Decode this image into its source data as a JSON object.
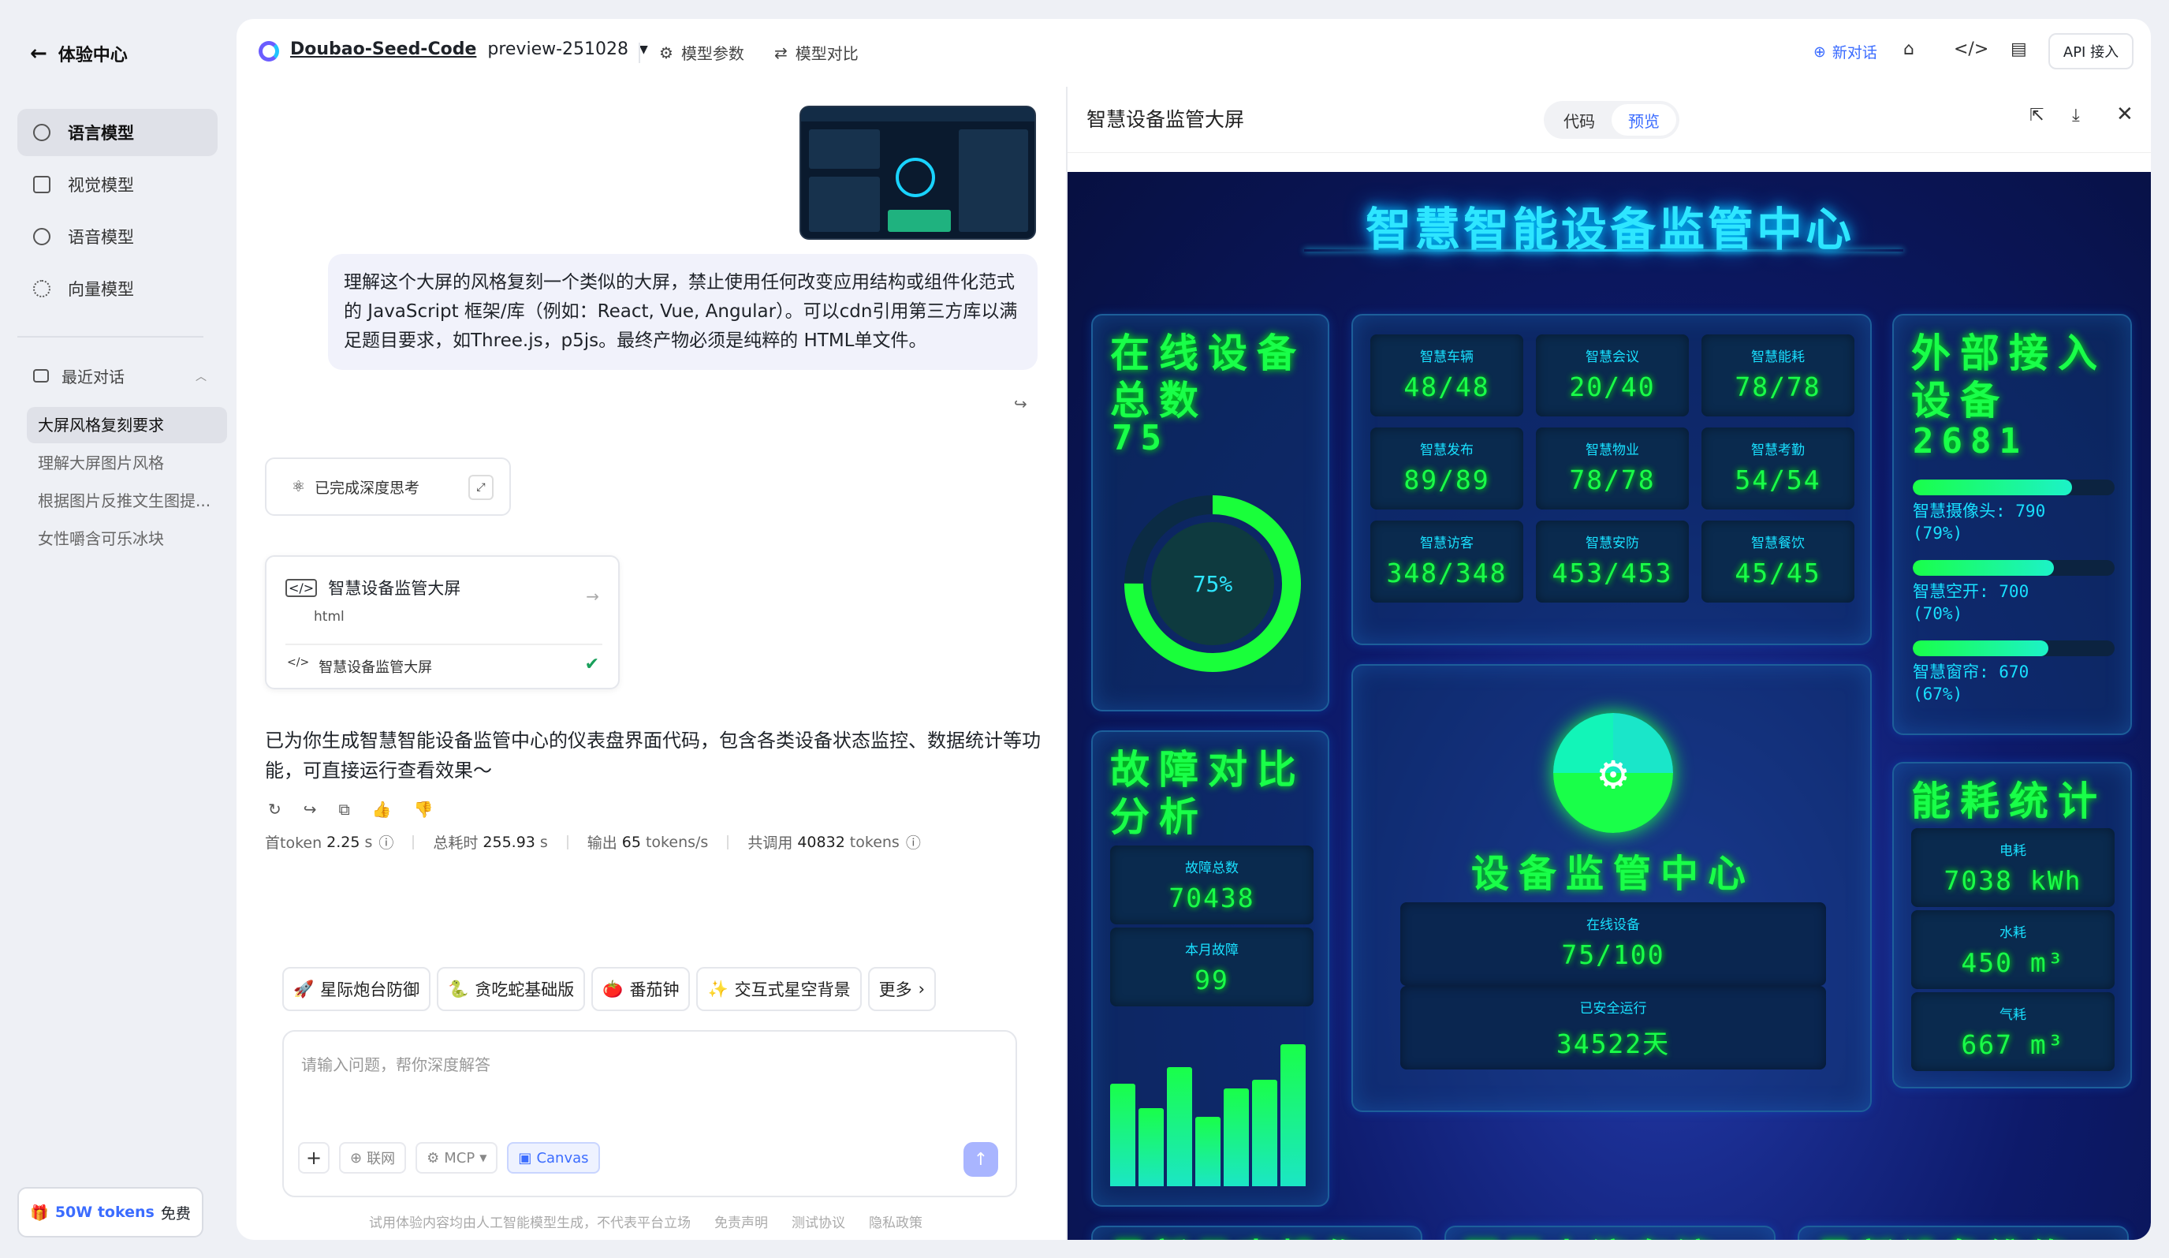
{
  "sidebar": {
    "back": "体验中心",
    "nav": [
      "语言模型",
      "视觉模型",
      "语音模型",
      "向量模型"
    ],
    "recent_title": "最近对话",
    "recent": [
      "大屏风格复刻要求",
      "理解大屏图片风格",
      "根据图片反推文生图提...",
      "女性嚼含可乐冰块"
    ],
    "promo_blue": "50W tokens",
    "promo_text": "免费"
  },
  "topbar": {
    "model_name": "Doubao-Seed-Code",
    "model_version": "preview-251028",
    "params": "模型参数",
    "compare": "模型对比",
    "new_chat": "新对话",
    "api": "API 接入"
  },
  "chat": {
    "user_message": "理解这个大屏的风格复刻一个类似的大屏，禁止使用任何改变应用结构或组件化范式的 JavaScript 框架/库（例如：React, Vue, Angular）。可以cdn引用第三方库以满足题目要求，如Three.js，p5js。最终产物必须是纯粹的 HTML单文件。",
    "thinking": "已完成深度思考",
    "card_title": "智慧设备监管大屏",
    "card_type": "html",
    "card_file": "智慧设备监管大屏",
    "answer": "已为你生成智慧智能设备监管中心的仪表盘界面代码，包含各类设备状态监控、数据统计等功能，可直接运行查看效果～",
    "stats": {
      "first_label": "首token",
      "first_value": "2.25",
      "first_unit": "s",
      "total_label": "总耗时",
      "total_value": "255.93",
      "total_unit": "s",
      "out_label": "输出",
      "out_value": "65",
      "out_unit": "tokens/s",
      "calls_label": "共调用",
      "calls_value": "40832",
      "calls_unit": "tokens"
    },
    "chips": [
      "星际炮台防御",
      "贪吃蛇基础版",
      "番茄钟",
      "交互式星空背景",
      "更多"
    ],
    "placeholder": "请输入问题，帮你深度解答",
    "tools": [
      "联网",
      "MCP",
      "Canvas"
    ],
    "footer": [
      "试用体验内容均由人工智能模型生成，不代表平台立场",
      "免责声明",
      "测试协议",
      "隐私政策"
    ]
  },
  "panel": {
    "title": "智慧设备监管大屏",
    "tab_code": "代码",
    "tab_preview": "预览"
  },
  "dashboard": {
    "title": "智慧智能设备监管中心",
    "online_title": "在线设备总数",
    "online_value": "75",
    "online_pct": "75%",
    "online_fraction": 0.75,
    "tiles": [
      {
        "label": "智慧车辆",
        "value": "48/48"
      },
      {
        "label": "智慧会议",
        "value": "20/40"
      },
      {
        "label": "智慧能耗",
        "value": "78/78"
      },
      {
        "label": "智慧发布",
        "value": "89/89"
      },
      {
        "label": "智慧物业",
        "value": "78/78"
      },
      {
        "label": "智慧考勤",
        "value": "54/54"
      },
      {
        "label": "智慧访客",
        "value": "348/348"
      },
      {
        "label": "智慧安防",
        "value": "453/453"
      },
      {
        "label": "智慧餐饮",
        "value": "45/45"
      }
    ],
    "external_title": "外部接入设备",
    "external_value": "2681",
    "external": [
      {
        "label": "智慧摄像头: 790",
        "pct": "(79%)",
        "fraction": 0.79
      },
      {
        "label": "智慧空开: 700",
        "pct": "(70%)",
        "fraction": 0.7
      },
      {
        "label": "智慧窗帘: 670",
        "pct": "(67%)",
        "fraction": 0.67
      }
    ],
    "fault_title": "故障对比分析",
    "fault_total_label": "故障总数",
    "fault_total": "70438",
    "fault_month_label": "本月故障",
    "fault_month": "99",
    "fault_bars": [
      0.72,
      0.55,
      0.84,
      0.49,
      0.69,
      0.75,
      1.0
    ],
    "center_title": "设备监管中心",
    "center_online_label": "在线设备",
    "center_online": "75/100",
    "center_safe_label": "已安全运行",
    "center_safe": "34522天",
    "energy_title": "能耗统计",
    "energy": [
      {
        "label": "电耗",
        "value": "7038 kWh"
      },
      {
        "label": "水耗",
        "value": "450 m³"
      },
      {
        "label": "气耗",
        "value": "667 m³"
      }
    ],
    "bottom_titles": [
      "最新日志操作",
      "园区人流车流",
      "最新设备维修"
    ]
  }
}
